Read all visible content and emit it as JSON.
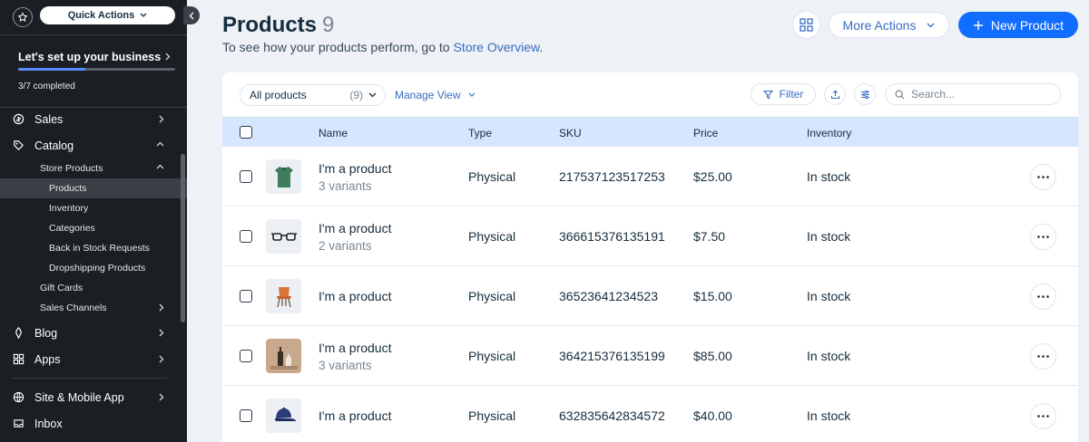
{
  "sidebar": {
    "quick_actions": "Quick Actions",
    "setup": {
      "title": "Let's set up your business",
      "progress_text": "3/7 completed",
      "progress_fraction": 0.43
    },
    "nav": {
      "sales": "Sales",
      "catalog": "Catalog",
      "store_products": "Store Products",
      "products": "Products",
      "inventory": "Inventory",
      "categories": "Categories",
      "back_in_stock": "Back in Stock Requests",
      "dropshipping": "Dropshipping Products",
      "gift_cards": "Gift Cards",
      "sales_channels": "Sales Channels",
      "blog": "Blog",
      "apps": "Apps",
      "site_mobile": "Site & Mobile App",
      "inbox": "Inbox"
    }
  },
  "header": {
    "title": "Products",
    "count": "9",
    "subtitle": "To see how your products perform, go to",
    "subtitle_link": "Store Overview",
    "subtitle_end": ".",
    "more_actions": "More Actions",
    "new_product": "New Product"
  },
  "toolbar": {
    "filter_select": "All products",
    "filter_count": "(9)",
    "manage_view": "Manage View",
    "filter": "Filter",
    "search_placeholder": "Search..."
  },
  "table": {
    "columns": {
      "name": "Name",
      "type": "Type",
      "sku": "SKU",
      "price": "Price",
      "inventory": "Inventory"
    },
    "rows": [
      {
        "name": "I'm a product",
        "variants": "3 variants",
        "type": "Physical",
        "sku": "217537123517253",
        "price": "$25.00",
        "inventory": "In stock",
        "thumb": "green-shirt-icon"
      },
      {
        "name": "I'm a product",
        "variants": "2 variants",
        "type": "Physical",
        "sku": "366615376135191",
        "price": "$7.50",
        "inventory": "In stock",
        "thumb": "glasses-icon"
      },
      {
        "name": "I'm a product",
        "variants": "",
        "type": "Physical",
        "sku": "36523641234523",
        "price": "$15.00",
        "inventory": "In stock",
        "thumb": "chair-icon"
      },
      {
        "name": "I'm a product",
        "variants": "3 variants",
        "type": "Physical",
        "sku": "364215376135199",
        "price": "$85.00",
        "inventory": "In stock",
        "thumb": "bottles-icon"
      },
      {
        "name": "I'm a product",
        "variants": "",
        "type": "Physical",
        "sku": "632835642834572",
        "price": "$40.00",
        "inventory": "In stock",
        "thumb": "cap-icon"
      }
    ]
  },
  "colors": {
    "accent": "#116dff",
    "sidebar_bg": "#1b1f24",
    "table_header": "#d6e6fe",
    "link": "#3a6cc2"
  }
}
